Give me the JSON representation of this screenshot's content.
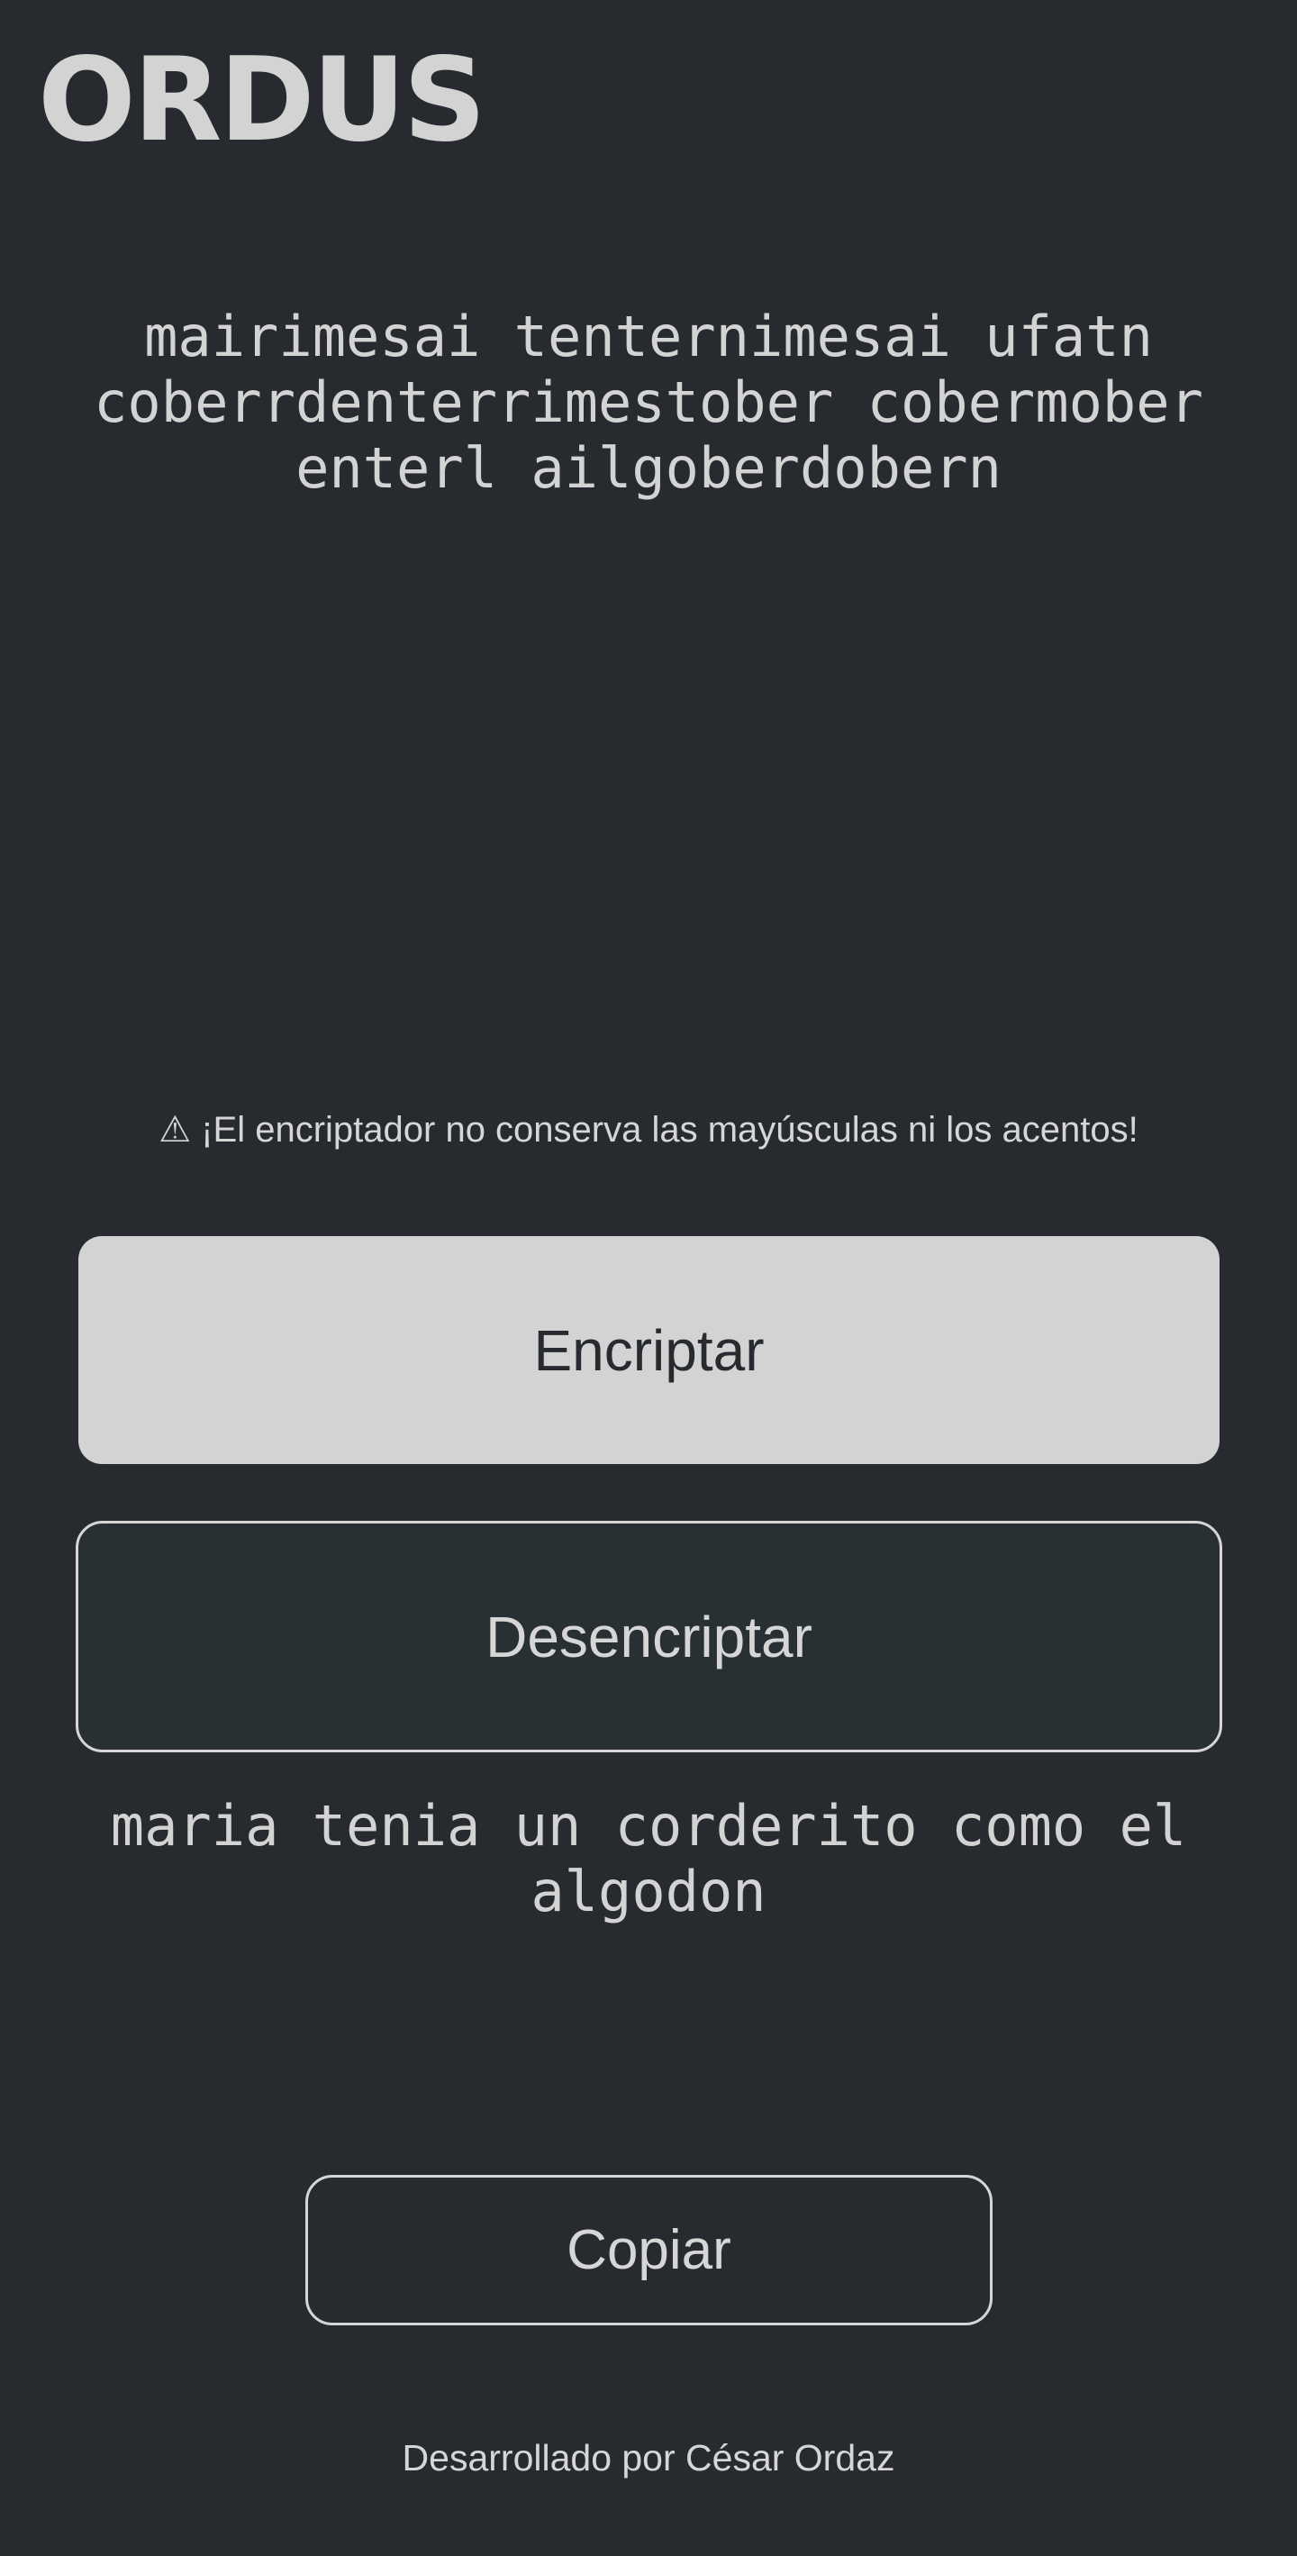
{
  "header": {
    "logo_text": "ORDUS"
  },
  "input": {
    "value": "mairimesai tenternimesai ufatn coberrdenterrimestober cobermober enterl ailgoberdobern"
  },
  "warning": {
    "text": "⚠ ¡El encriptador no conserva las mayúsculas ni los acentos!"
  },
  "actions": {
    "encrypt_label": "Encriptar",
    "decrypt_label": "Desencriptar"
  },
  "output": {
    "text": "maria tenia un corderito como el algodon",
    "copy_label": "Copiar"
  },
  "footer": {
    "credit": "Desarrollado por César Ordaz"
  },
  "colors": {
    "background": "#272b2f",
    "text": "#d6d6d6",
    "primary_button_bg": "#d3d3d3",
    "primary_button_text": "#272b2f",
    "secondary_button_bg": "#283034",
    "border": "#d6d6d6"
  }
}
